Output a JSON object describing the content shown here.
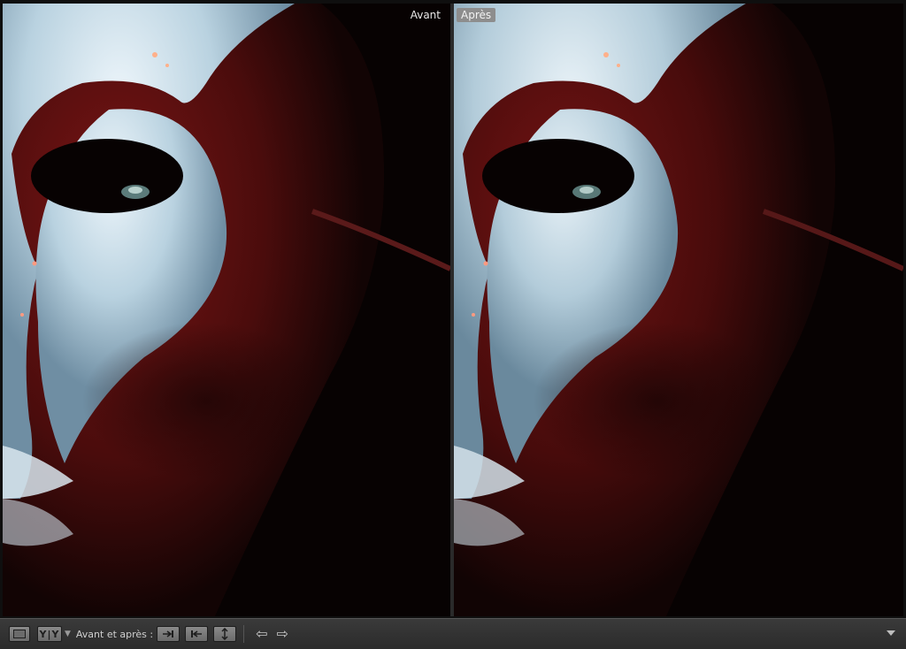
{
  "panes": {
    "before_label": "Avant",
    "after_label": "Après"
  },
  "toolbar": {
    "single_view_icon": "loupe-view-icon",
    "compare_icon": "before-after-yy-icon",
    "compare_text": "Y|Y",
    "compare_mode_label": "Avant et après :",
    "copy_before_to_after_icon": "copy-before-to-after-icon",
    "copy_after_to_before_icon": "copy-after-to-before-icon",
    "swap_icon": "swap-before-after-icon",
    "prev_icon": "arrow-left-icon",
    "next_icon": "arrow-right-icon",
    "menu_icon": "toolbar-menu-triangle-icon"
  },
  "colors": {
    "mask_white": "#c9dde8",
    "mask_red": "#6e1212",
    "background": "#0a0303"
  }
}
